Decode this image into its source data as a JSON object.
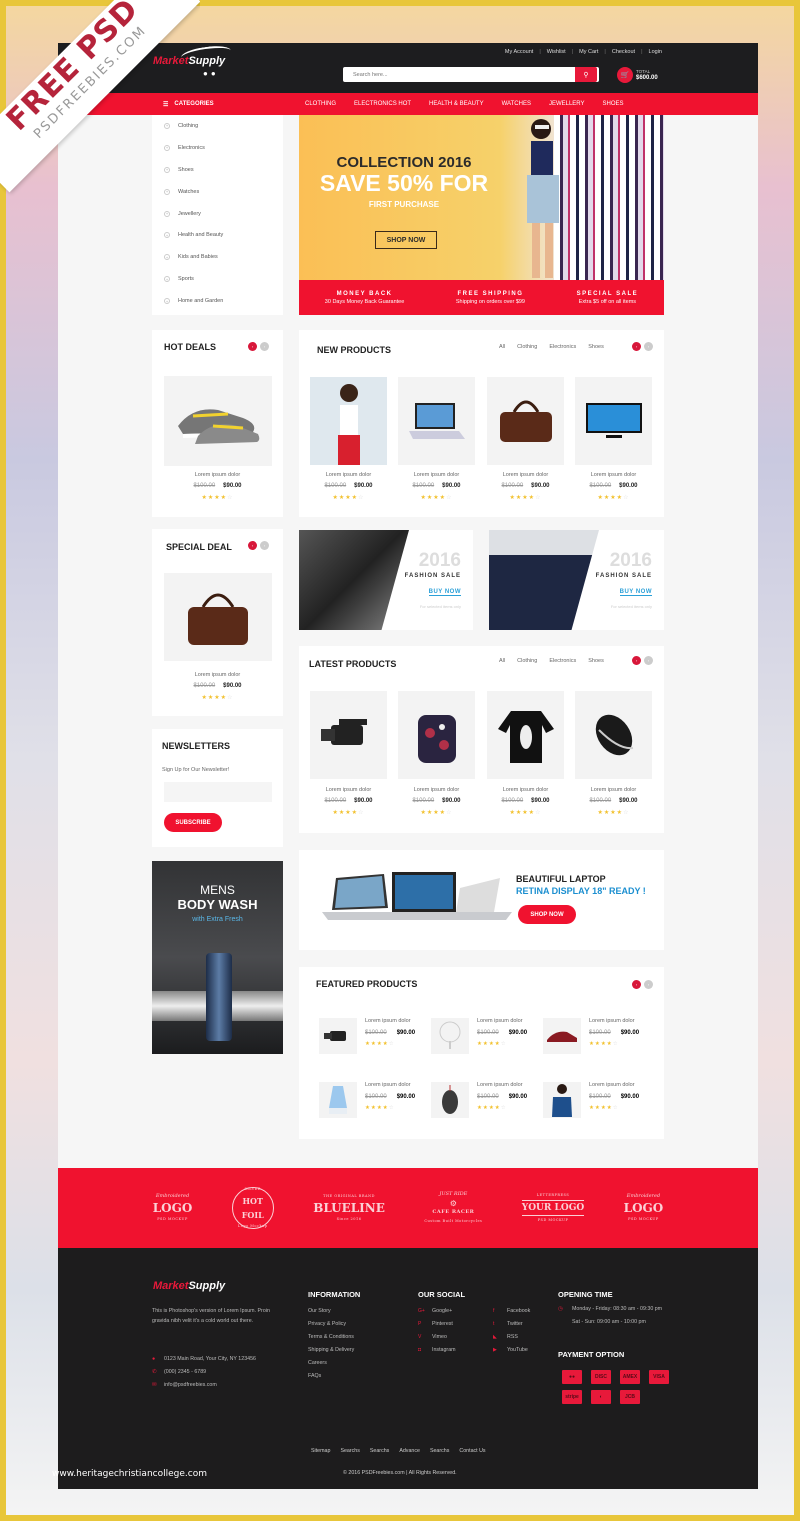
{
  "ribbon": {
    "title": "FREE PSD",
    "subtitle": "PSDFREEBIES.COM"
  },
  "header": {
    "logo": {
      "part1": "Market",
      "part2": "Supply"
    },
    "top_links": [
      "My Account",
      "Wishlist",
      "My Cart",
      "Checkout",
      "Login"
    ],
    "search": {
      "placeholder": "Search here...",
      "icon": "search-icon"
    },
    "cart": {
      "label": "TOTAL",
      "total": "$600.00",
      "icon": "cart-icon"
    }
  },
  "nav": {
    "categories_label": "CATEGORIES",
    "menu": [
      "CLOTHING",
      "ELECTRONICS HOT",
      "HEALTH & BEAUTY",
      "WATCHES",
      "JEWELLERY",
      "SHOES"
    ]
  },
  "sidebar": {
    "categories": [
      "Clothing",
      "Electronics",
      "Shoes",
      "Watches",
      "Jewellery",
      "Health and Beauty",
      "Kids and Babies",
      "Sports",
      "Home and Garden"
    ]
  },
  "hero": {
    "line1": "COLLECTION 2016",
    "line2": "SAVE 50% FOR",
    "line3": "FIRST PURCHASE",
    "button": "SHOP NOW",
    "features": [
      {
        "title": "MONEY BACK",
        "text": "30 Days Money Back Guarantee"
      },
      {
        "title": "FREE SHIPPING",
        "text": "Shipping on orders over $99"
      },
      {
        "title": "SPECIAL SALE",
        "text": "Extra $5 off on all items"
      }
    ]
  },
  "hot_deals": {
    "title": "HOT DEALS",
    "product": {
      "name": "Lorem ipsum dolor",
      "old": "$100.00",
      "price": "$90.00",
      "rating": 4
    }
  },
  "special_deal": {
    "title": "SPECIAL DEAL",
    "product": {
      "name": "Lorem ipsum dolor",
      "old": "$100.00",
      "price": "$90.00",
      "rating": 4
    }
  },
  "filters": [
    "All",
    "Clothing",
    "Electronics",
    "Shoes"
  ],
  "new_products": {
    "title": "NEW PRODUCTS",
    "items": [
      {
        "name": "Lorem ipsum dolor",
        "old": "$100.00",
        "price": "$90.00",
        "rating": 4,
        "image": "woman-model"
      },
      {
        "name": "Lorem ipsum dolor",
        "old": "$100.00",
        "price": "$90.00",
        "rating": 4,
        "image": "laptop"
      },
      {
        "name": "Lorem ipsum dolor",
        "old": "$100.00",
        "price": "$90.00",
        "rating": 4,
        "image": "leather-bag"
      },
      {
        "name": "Lorem ipsum dolor",
        "old": "$100.00",
        "price": "$90.00",
        "rating": 4,
        "image": "tv"
      }
    ]
  },
  "fashion_banners": [
    {
      "year": "2016",
      "title": "FASHION SALE",
      "cta": "BUY NOW",
      "sub": "For selected items only"
    },
    {
      "year": "2016",
      "title": "FASHION SALE",
      "cta": "BUY NOW",
      "sub": "For selected items only"
    }
  ],
  "latest_products": {
    "title": "LATEST PRODUCTS",
    "items": [
      {
        "name": "Lorem ipsum dolor",
        "old": "$100.00",
        "price": "$90.00",
        "rating": 4,
        "image": "camcorder"
      },
      {
        "name": "Lorem ipsum dolor",
        "old": "$100.00",
        "price": "$90.00",
        "rating": 4,
        "image": "backpack"
      },
      {
        "name": "Lorem ipsum dolor",
        "old": "$100.00",
        "price": "$90.00",
        "rating": 4,
        "image": "sweater"
      },
      {
        "name": "Lorem ipsum dolor",
        "old": "$100.00",
        "price": "$90.00",
        "rating": 4,
        "image": "mouse"
      }
    ]
  },
  "newsletter": {
    "title": "NEWSLETTERS",
    "text": "Sign Up for Our Newsletter!",
    "placeholder": "",
    "button": "SUBSCRIBE"
  },
  "mens_ad": {
    "line1": "MENS",
    "line2": "BODY WASH",
    "line3": "with Extra Fresh"
  },
  "laptop_ad": {
    "line1": "BEAUTIFUL LAPTOP",
    "line2": "RETINA DISPLAY 18\" READY !",
    "button": "SHOP NOW"
  },
  "featured": {
    "title": "FEATURED PRODUCTS",
    "items": [
      {
        "name": "Lorem ipsum dolor",
        "old": "$100.00",
        "price": "$90.00",
        "rating": 4,
        "image": "camcorder"
      },
      {
        "name": "Lorem ipsum dolor",
        "old": "$100.00",
        "price": "$90.00",
        "rating": 4,
        "image": "fan"
      },
      {
        "name": "Lorem ipsum dolor",
        "old": "$100.00",
        "price": "$90.00",
        "rating": 4,
        "image": "sneaker"
      },
      {
        "name": "Lorem ipsum dolor",
        "old": "$100.00",
        "price": "$90.00",
        "rating": 4,
        "image": "humidifier"
      },
      {
        "name": "Lorem ipsum dolor",
        "old": "$100.00",
        "price": "$90.00",
        "rating": 4,
        "image": "gaming-mouse"
      },
      {
        "name": "Lorem ipsum dolor",
        "old": "$100.00",
        "price": "$90.00",
        "rating": 4,
        "image": "woman-top"
      }
    ]
  },
  "brand_logos": [
    {
      "top": "Embroidered",
      "main": "LOGO",
      "bottom": "PSD MOCKUP"
    },
    {
      "top": "SILVER",
      "main": "HOT FOIL",
      "bottom": "Logo Mockup"
    },
    {
      "top": "THE ORIGINAL BRAND",
      "main": "BLUELINE",
      "bottom": "Since 2016"
    },
    {
      "top": "JUST RIDE",
      "main": "CAFE RACER",
      "bottom": "Custom Built Motorcycles"
    },
    {
      "top": "LETTERPRESS",
      "main": "YOUR LOGO",
      "bottom": "PSD MOCKUP"
    },
    {
      "top": "Embroidered",
      "main": "LOGO",
      "bottom": "PSD MOCKUP"
    }
  ],
  "footer": {
    "description": "This is Photoshop's version of Lorem Ipsum. Proin gravida nibh velit it's a cold world out there.",
    "address": "0123 Main Road, Your City, NY 123456",
    "phone": "(000) 2345 - 6789",
    "email": "info@psdfreebies.com",
    "information_title": "INFORMATION",
    "information_links": [
      "Our Story",
      "Privacy & Policy",
      "Terms & Conditions",
      "Shipping & Delivery",
      "Careers",
      "FAQs"
    ],
    "social_title": "OUR SOCIAL",
    "social_col1": [
      "Google+",
      "Pinterest",
      "Vimeo",
      "Instagram"
    ],
    "social_col2": [
      "Facebook",
      "Twitter",
      "RSS",
      "YouTube"
    ],
    "opening_title": "OPENING TIME",
    "hours": [
      "Monday - Friday: 08:30 am - 09:30 pm",
      "Sat - Sun: 09:00 am - 10:00 pm"
    ],
    "payment_title": "PAYMENT OPTION",
    "payments": [
      "MasterCard",
      "Discover",
      "AmEx",
      "VISA",
      "Stripe",
      "Diners",
      "JCB"
    ],
    "bottom_links": [
      "Sitemap",
      "Searchs",
      "Searchs",
      "Advance",
      "Searchs",
      "Contact Us"
    ],
    "copyright": "© 2016 PSDFreebies.com  |  All Rights Reserved."
  },
  "watermark": "www.heritagechristiancollege.com",
  "colors": {
    "accent": "#f0122f",
    "dark": "#1d1d1f",
    "star": "#f2c12e",
    "link_blue": "#1c8fd0"
  }
}
